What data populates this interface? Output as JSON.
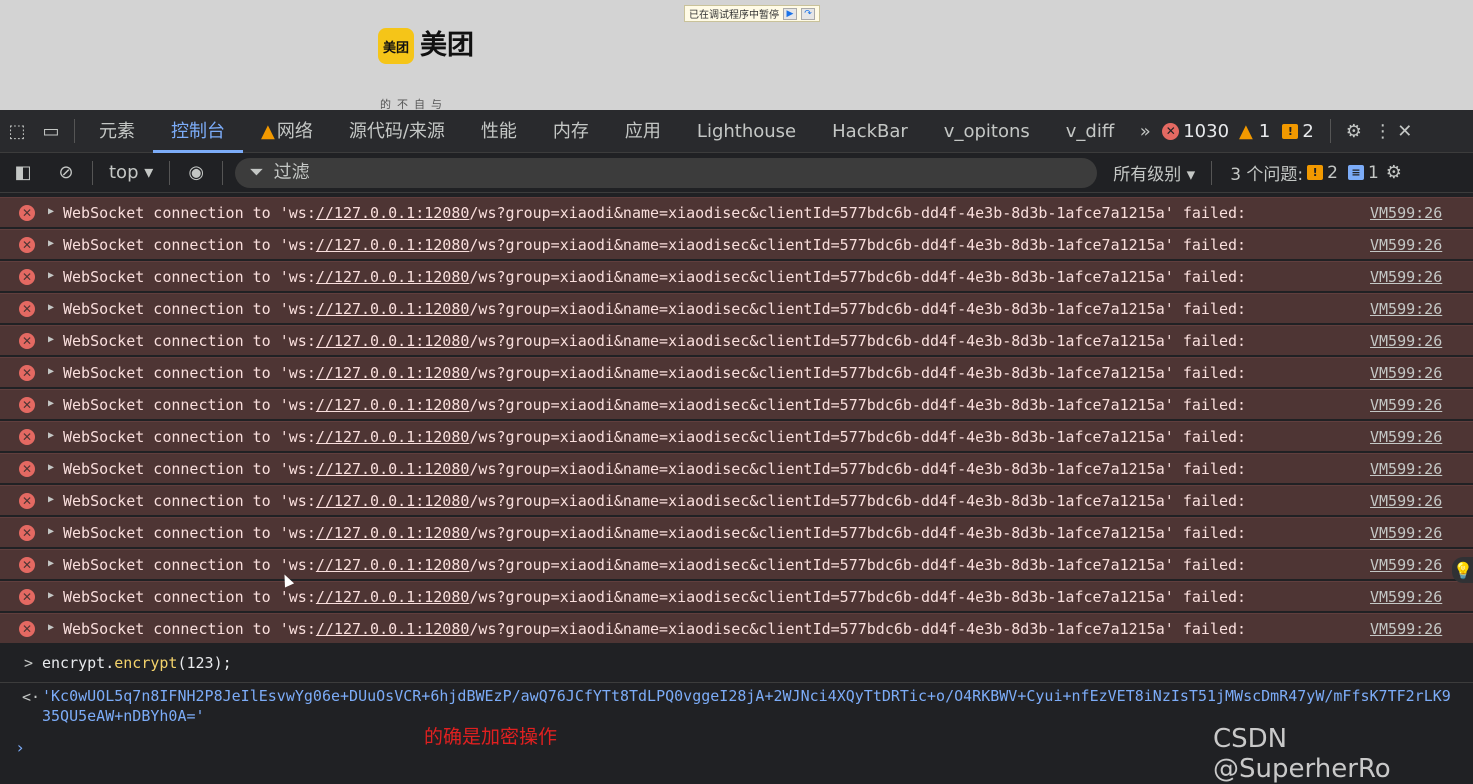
{
  "page": {
    "paused_banner": "已在调试程序中暂停",
    "logo_icon_text": "美团",
    "logo_text": "美团",
    "cut_text": "的不自与"
  },
  "tabs": {
    "items": [
      {
        "label": "元素"
      },
      {
        "label": "控制台"
      },
      {
        "label": "网络"
      },
      {
        "label": "源代码/来源"
      },
      {
        "label": "性能"
      },
      {
        "label": "内存"
      },
      {
        "label": "应用"
      },
      {
        "label": "Lighthouse"
      },
      {
        "label": "HackBar"
      },
      {
        "label": "v_opitons"
      },
      {
        "label": "v_diff"
      }
    ],
    "active": "控制台",
    "error_count": "1030",
    "warning_count": "1",
    "issue_count": "2"
  },
  "toolbar": {
    "context": "top ▾",
    "filter_placeholder": "过滤",
    "levels": "所有级别 ▾",
    "issues_label": "3 个问题:",
    "issues_warn": "2",
    "issues_info": "1"
  },
  "messages": {
    "prefix": "WebSocket connection to 'ws:",
    "link": "//127.0.0.1:12080",
    "suffix": "/ws?group=xiaodi&name=xiaodisec&clientId=577bdc6b-dd4f-4e3b-8d3b-1afce7a1215a' failed:",
    "source": "VM599:26",
    "count": 14
  },
  "console": {
    "input_obj": "encrypt.",
    "input_fn": "encrypt",
    "input_args": "(123);",
    "result": "'Kc0wUOL5q7n8IFNH2P8JeIlEsvwYg06e+DUuOsVCR+6hjdBWEzP/awQ76JCfYTt8TdLPQ0vggeI28jA+2WJNci4XQyTtDRTic+o/O4RKBWV+Cyui+nfEzVET8iNzIsT51jMWscDmR47yW/mFfsK7TF2rLK935QU5eAW+nDBYh0A='"
  },
  "annotation": "的确是加密操作",
  "watermark": "CSDN @SuperherRo",
  "colors": {
    "accent": "#7cacf8",
    "error_row": "#4e3534",
    "error_icon": "#e46962",
    "warning": "#f29900",
    "annotation": "#e02020"
  }
}
